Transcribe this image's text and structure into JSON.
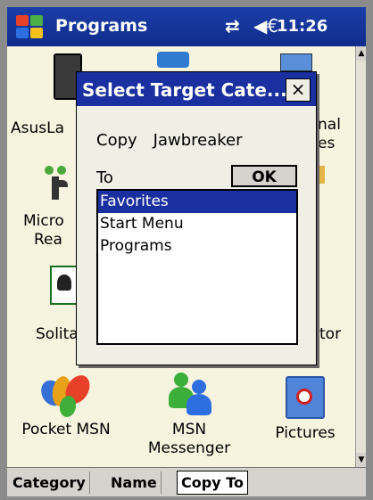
{
  "titlebar": {
    "title": "Programs",
    "time": "11:26",
    "connectivity_icon": "connectivity-icon",
    "volume_icon": "volume-icon"
  },
  "programs": {
    "asus_partial": "AsusLa",
    "right_top_partial_1": "nal",
    "right_top_partial_2": "es",
    "micro_partial_1": "Micro",
    "micro_partial_2": "Rea",
    "solita_partial": "Solita",
    "right_mid_partial": "tor",
    "pocket_msn": "Pocket MSN",
    "msn_messenger_line1": "MSN",
    "msn_messenger_line2": "Messenger",
    "pictures": "Pictures"
  },
  "dialog": {
    "title": "Select Target Cate...",
    "close_label": "×",
    "copy_label": "Copy",
    "item_name": "Jawbreaker",
    "to_label": "To",
    "ok_label": "OK",
    "categories": [
      "Favorites",
      "Start Menu",
      "Programs"
    ],
    "selected": "Favorites"
  },
  "menubar": {
    "category": "Category",
    "name": "Name",
    "copy_to": "Copy To"
  },
  "colors": {
    "titlebar": "#1b3ea8",
    "selection": "#1a2fa0",
    "background": "#f6f3df"
  }
}
